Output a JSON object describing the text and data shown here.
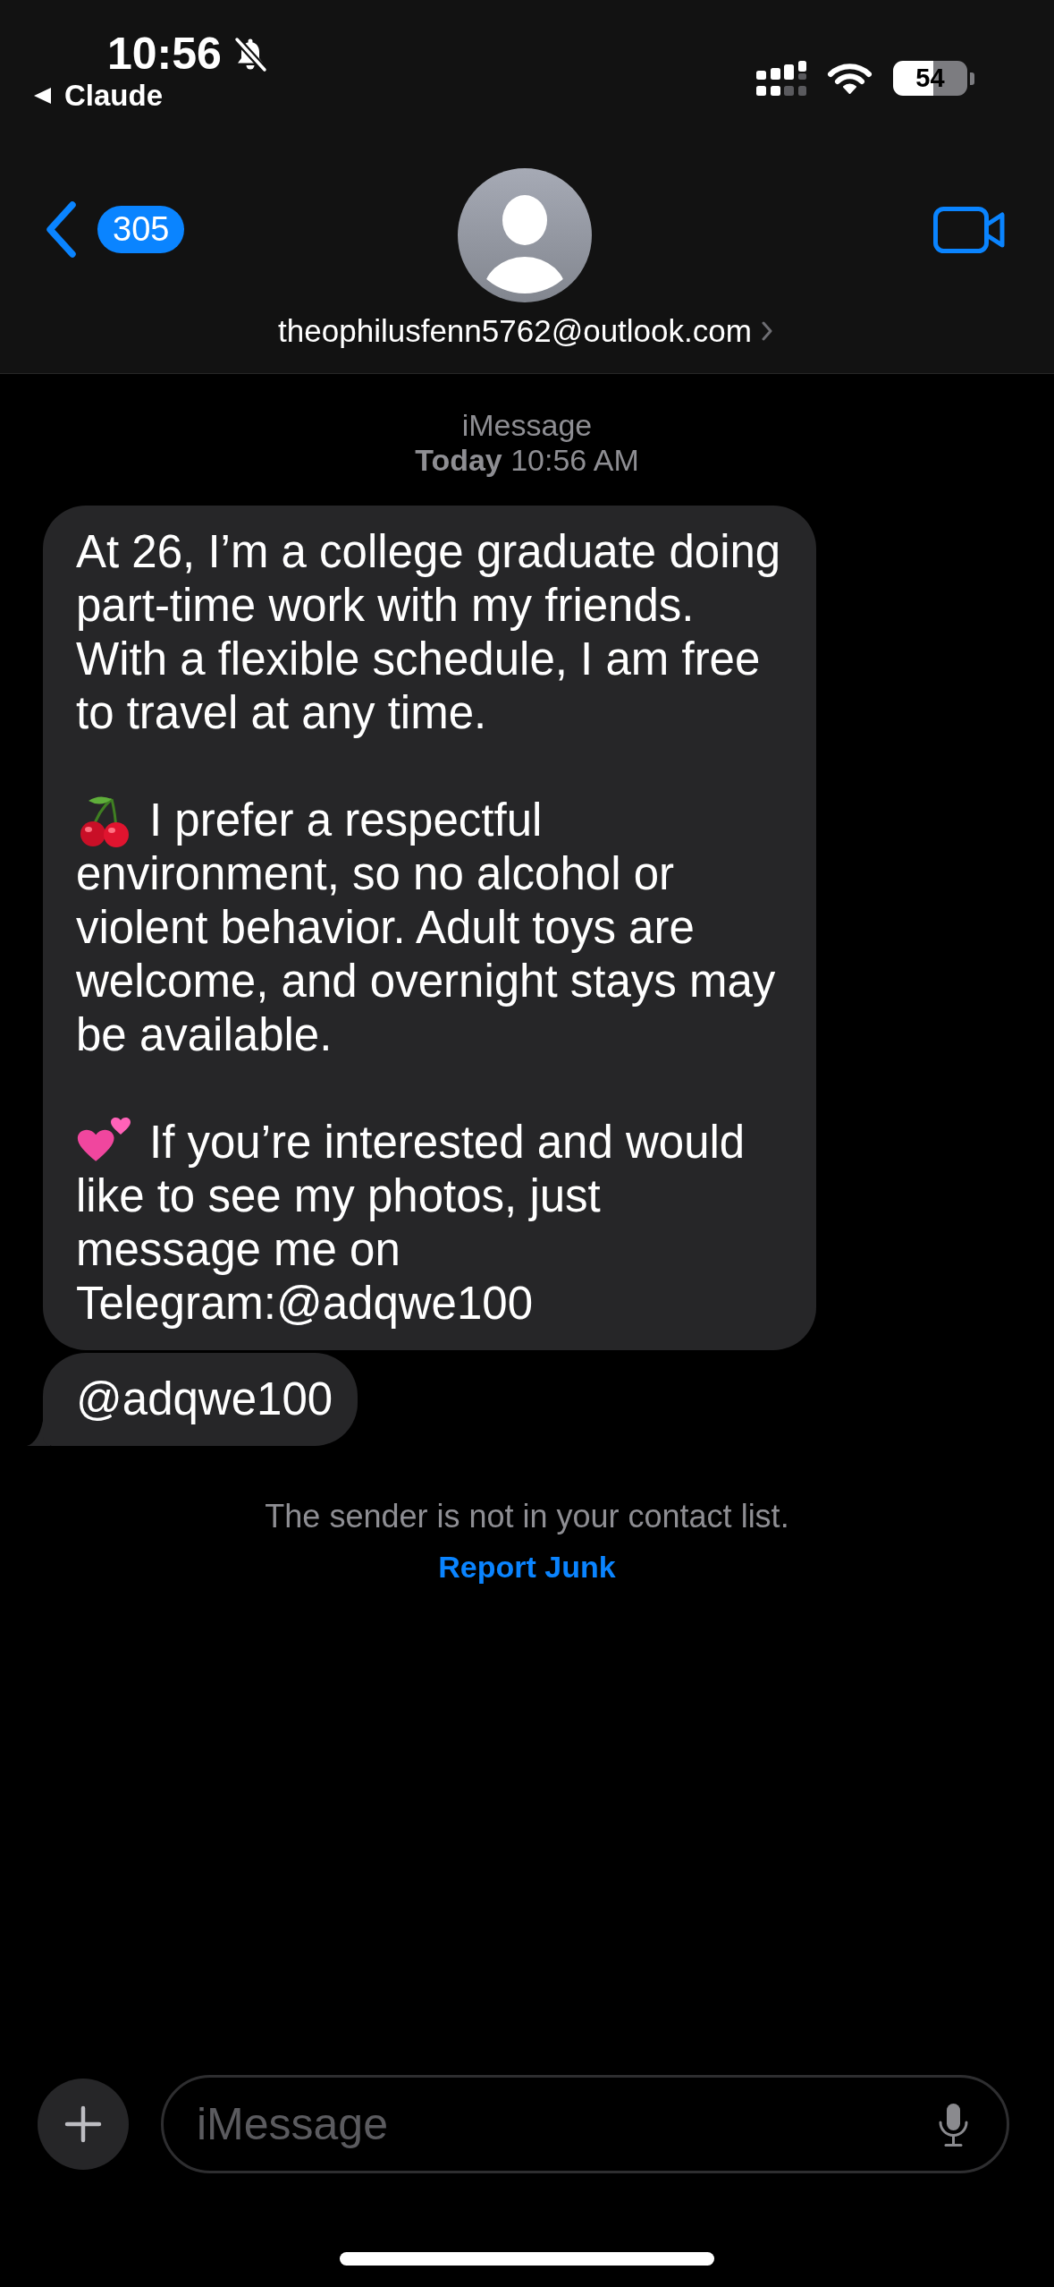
{
  "status_bar": {
    "time": "10:56",
    "silent": true,
    "back_app": "Claude",
    "battery": "54"
  },
  "header": {
    "unread_count": "305",
    "contact": "theophilusfenn5762@outlook.com"
  },
  "thread": {
    "service": "iMessage",
    "timestamp": "**Today** 10:56 AM"
  },
  "messages": [
    {
      "tail": false,
      "paragraphs": [
        {
          "kind": "plain",
          "text": "At 26, I’m a college graduate doing part-time work with my friends. With a flexible schedule, I am free to travel at any time."
        },
        {
          "kind": "cherries",
          "text": "I prefer a respectful environment, so no alcohol or violent behavior. Adult toys are welcome, and overnight stays may be available."
        },
        {
          "kind": "hearts",
          "text": "If you’re interested and would like to see my photos, just message me on Telegram:@adqwe100"
        }
      ]
    },
    {
      "tail": true,
      "paragraphs": [
        {
          "kind": "plain",
          "text": "@adqwe100"
        }
      ]
    }
  ],
  "notice": {
    "text": "The sender is not in your contact list.",
    "action": "Report Junk"
  },
  "composer": {
    "placeholder": "iMessage"
  }
}
